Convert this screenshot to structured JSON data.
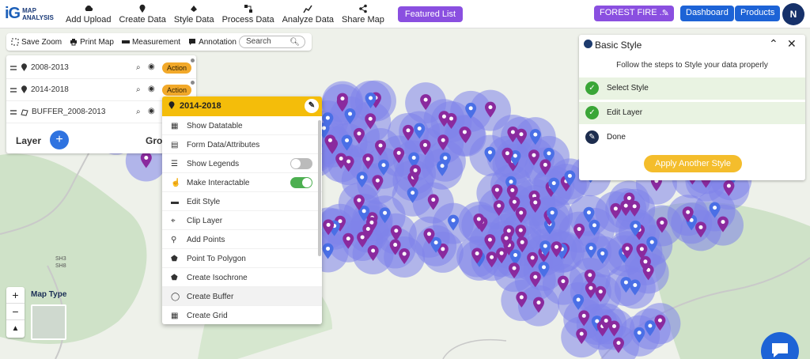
{
  "logo": {
    "mark": "iG",
    "line1": "MAP",
    "line2": "ANALYSIS"
  },
  "nav": [
    "Add Upload",
    "Create Data",
    "Style Data",
    "Process Data",
    "Analyze Data",
    "Share Map"
  ],
  "featured": "Featured List",
  "project": "FOREST FIRE ...",
  "dashboard": "Dashboard",
  "products": "Products",
  "user_initial": "N",
  "toolbar": {
    "save_zoom": "Save Zoom",
    "print_map": "Print Map",
    "measurement": "Measurement",
    "annotation": "Annotation",
    "search_placeholder": "Search"
  },
  "layers": [
    {
      "name": "2008-2013",
      "action": "Action"
    },
    {
      "name": "2014-2018",
      "action": "Action"
    },
    {
      "name": "BUFFER_2008-2013",
      "action": "Action"
    }
  ],
  "layer_label": "Layer",
  "add_symbol": "+",
  "group_label": "Group",
  "context_menu": {
    "title": "2014-2018",
    "items": [
      "Show Datatable",
      "Form Data/Attributes",
      "Show Legends",
      "Make Interactable",
      "Edit Style",
      "Clip Layer",
      "Add Points",
      "Point To Polygon",
      "Create Isochrone",
      "Create Buffer",
      "Create Grid"
    ],
    "toggles": {
      "show_legends": false,
      "make_interactable": true
    }
  },
  "style_panel": {
    "title": "Basic Style",
    "subtitle": "Follow the steps to Style your data properly",
    "steps": [
      {
        "label": "Select Style",
        "state": "done"
      },
      {
        "label": "Edit Layer",
        "state": "done"
      },
      {
        "label": "Done",
        "state": "current"
      }
    ],
    "apply_button": "Apply Another Style"
  },
  "map": {
    "zoom_in": "+",
    "zoom_out": "−",
    "compass": "▲",
    "map_type_label": "Map Type",
    "road_labels": [
      "SH3",
      "SH8"
    ]
  },
  "colors": {
    "accent": "#1d63d6",
    "purple": "#8a4fe0",
    "marker": "#8a2a9e",
    "buffer": "#7f83ea",
    "action": "#f2a92a",
    "header_yellow": "#f4bd0a"
  }
}
